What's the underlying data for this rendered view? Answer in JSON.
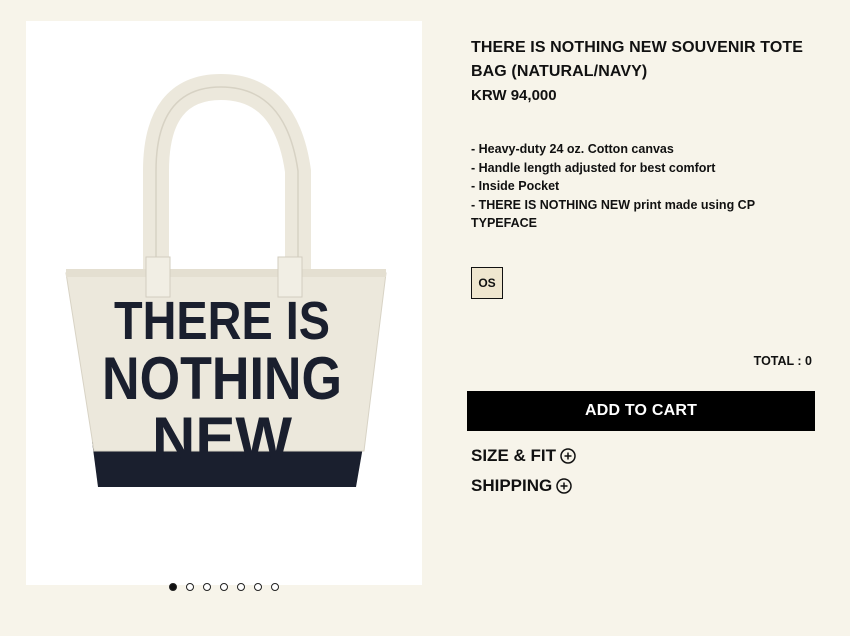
{
  "product": {
    "title": "THERE IS NOTHING NEW SOUVENIR TOTE BAG (NATURAL/NAVY)",
    "price": "KRW 94,000",
    "description": [
      "- Heavy-duty 24 oz. Cotton canvas",
      "- Handle length adjusted for best comfort",
      "- Inside Pocket",
      "- THERE IS NOTHING NEW print made using CP TYPEFACE"
    ],
    "print_text": [
      "THERE IS",
      "NOTHING",
      "NEW"
    ]
  },
  "gallery": {
    "image_count": 7,
    "active_index": 0
  },
  "options": {
    "sizes": [
      "OS"
    ]
  },
  "total": "TOTAL : 0",
  "cart_button": "ADD TO CART",
  "accordions": {
    "size_fit": "SIZE & FIT",
    "shipping": "SHIPPING"
  },
  "colors": {
    "background": "#f7f4ea",
    "canvas": "#ece8dc",
    "navy_print": "#1a1f2e",
    "button": "#000000",
    "size_selected": "#efe6cf"
  },
  "icons": {
    "accordion": "plus-circle-icon"
  }
}
